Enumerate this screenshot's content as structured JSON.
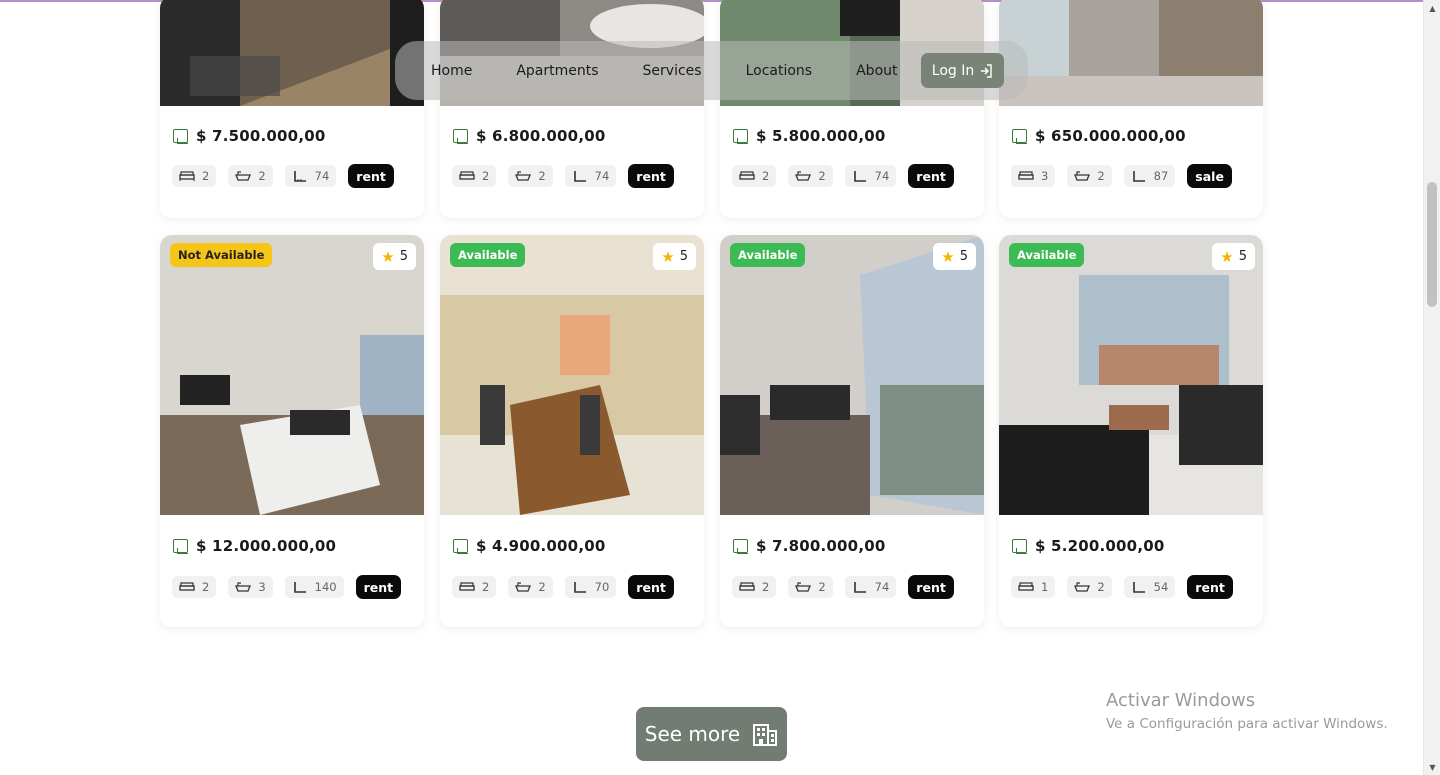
{
  "nav": {
    "items": [
      "Home",
      "Apartments",
      "Services",
      "Locations",
      "About"
    ],
    "login_label": "Log In"
  },
  "cards_row1": [
    {
      "price": "$ 7.500.000,00",
      "beds": "2",
      "baths": "2",
      "area": "74",
      "type": "rent"
    },
    {
      "price": "$ 6.800.000,00",
      "beds": "2",
      "baths": "2",
      "area": "74",
      "type": "rent"
    },
    {
      "price": "$ 5.800.000,00",
      "beds": "2",
      "baths": "2",
      "area": "74",
      "type": "rent"
    },
    {
      "price": "$ 650.000.000,00",
      "beds": "3",
      "baths": "2",
      "area": "87",
      "type": "sale"
    }
  ],
  "cards_row2": [
    {
      "status": "Not Available",
      "status_color": "#f5c518",
      "rating": "5",
      "price": "$ 12.000.000,00",
      "beds": "2",
      "baths": "3",
      "area": "140",
      "type": "rent"
    },
    {
      "status": "Available",
      "status_color": "#3cba54",
      "rating": "5",
      "price": "$ 4.900.000,00",
      "beds": "2",
      "baths": "2",
      "area": "70",
      "type": "rent"
    },
    {
      "status": "Available",
      "status_color": "#3cba54",
      "rating": "5",
      "price": "$ 7.800.000,00",
      "beds": "2",
      "baths": "2",
      "area": "74",
      "type": "rent"
    },
    {
      "status": "Available",
      "status_color": "#3cba54",
      "rating": "5",
      "price": "$ 5.200.000,00",
      "beds": "1",
      "baths": "2",
      "area": "54",
      "type": "rent"
    }
  ],
  "see_more_label": "See more",
  "watermark": {
    "title": "Activar Windows",
    "subtitle": "Ve a Configuración para activar Windows."
  },
  "colors": {
    "accent": "#737c72",
    "available": "#3cba54",
    "not_available": "#f5c518",
    "tag_bg": "#0a0a0a"
  }
}
